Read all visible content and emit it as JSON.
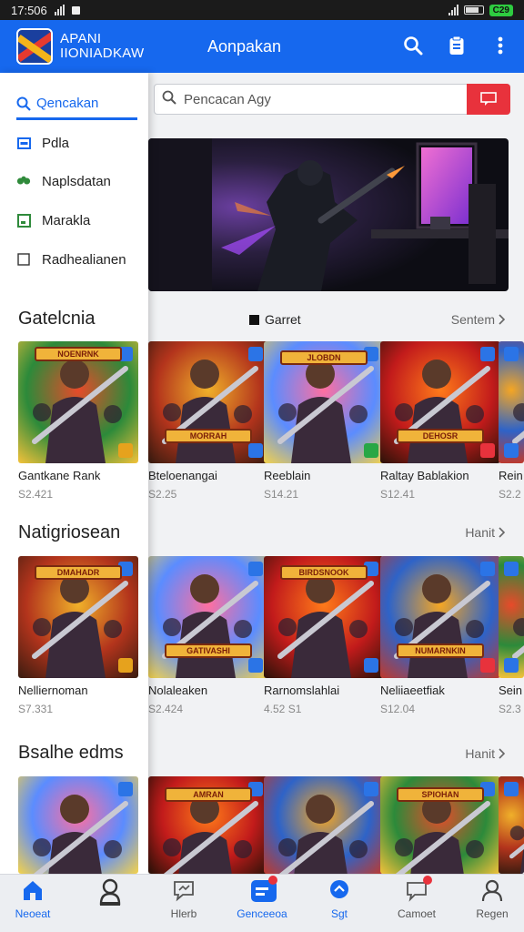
{
  "status_bar": {
    "time": "17:506",
    "battery_label": "C29"
  },
  "app_bar": {
    "brand_line1": "APANI",
    "brand_line2": "IIONIADKAW",
    "title": "Aonpakan",
    "icons": [
      "search-icon",
      "clipboard-icon",
      "more-vert-icon"
    ]
  },
  "drawer": {
    "search_label": "Qencakan",
    "items": [
      {
        "label": "Pdla",
        "icon": "rectangle-icon"
      },
      {
        "label": "Naplsdatan",
        "icon": "gamepad-icon"
      },
      {
        "label": "Marakla",
        "icon": "square-check-icon"
      },
      {
        "label": "Radhealianen",
        "icon": "checkbox-icon"
      }
    ]
  },
  "search": {
    "placeholder": "Pencacan Agy"
  },
  "sections": [
    {
      "title": "Gatelcnia",
      "center_label": "Garret",
      "more_label": "Sentem",
      "items": [
        {
          "name": "Gantkane Rank",
          "price": "S2.421",
          "banner": "NOENRNK",
          "badge_color": "#e6a21d"
        },
        {
          "name": "Bteloenangai",
          "price": "S2.25",
          "banner": "MORRAH",
          "badge_color": "#2b74e6"
        },
        {
          "name": "Reeblain",
          "price": "S14.21",
          "banner": "JLOBDN",
          "badge_color": "#28a745"
        },
        {
          "name": "Raltay Bablakion",
          "price": "S12.41",
          "banner": "DEHOSR",
          "badge_color": "#e8323c"
        },
        {
          "name": "Rein",
          "price": "S2.2",
          "banner": "",
          "badge_color": "#2b74e6"
        }
      ]
    },
    {
      "title": "Natigriosean",
      "center_label": "",
      "more_label": "Hanit",
      "items": [
        {
          "name": "Nelliernoman",
          "price": "S7.331",
          "banner": "DMAHADR",
          "badge_color": "#e6a21d"
        },
        {
          "name": "Nolaleaken",
          "price": "S2.424",
          "banner": "GATIVASHI",
          "badge_color": "#2b74e6"
        },
        {
          "name": "Rarnomslahlai",
          "price": "4.52 S1",
          "banner": "BIRDSNOOK",
          "badge_color": "#2b74e6"
        },
        {
          "name": "Neliiaeetfiak",
          "price": "S12.04",
          "banner": "NUMARNKIN",
          "badge_color": "#e8323c"
        },
        {
          "name": "Sein",
          "price": "S2.3",
          "banner": "",
          "badge_color": "#2b74e6"
        }
      ]
    },
    {
      "title": "Bsalhe edms",
      "center_label": "",
      "more_label": "Hanit",
      "items": [
        {
          "name": "",
          "price": "",
          "banner": "",
          "badge_color": "#2b74e6"
        },
        {
          "name": "",
          "price": "",
          "banner": "AMRAN",
          "badge_color": "#2b74e6"
        },
        {
          "name": "",
          "price": "",
          "banner": "",
          "badge_color": "#2b74e6"
        },
        {
          "name": "",
          "price": "",
          "banner": "SPIOHAN",
          "badge_color": "#2b74e6"
        },
        {
          "name": "",
          "price": "",
          "banner": "",
          "badge_color": "#2b74e6"
        }
      ]
    }
  ],
  "bottom_nav": [
    {
      "label": "Neoeat",
      "icon": "home-icon",
      "active": true
    },
    {
      "label": "",
      "icon": "person-icon",
      "active": false
    },
    {
      "label": "Hlerb",
      "icon": "chat-icon",
      "active": false
    },
    {
      "label": "Genceeoa",
      "icon": "gamepad-icon",
      "active": true
    },
    {
      "label": "Sgt",
      "icon": "location-icon",
      "active": true
    },
    {
      "label": "Camoet",
      "icon": "message-icon",
      "active": false
    },
    {
      "label": "Regen",
      "icon": "profile-icon",
      "active": false
    }
  ],
  "colors": {
    "primary": "#1668ee",
    "accent": "#e8323c",
    "banner_gold": "#f0b33a"
  }
}
